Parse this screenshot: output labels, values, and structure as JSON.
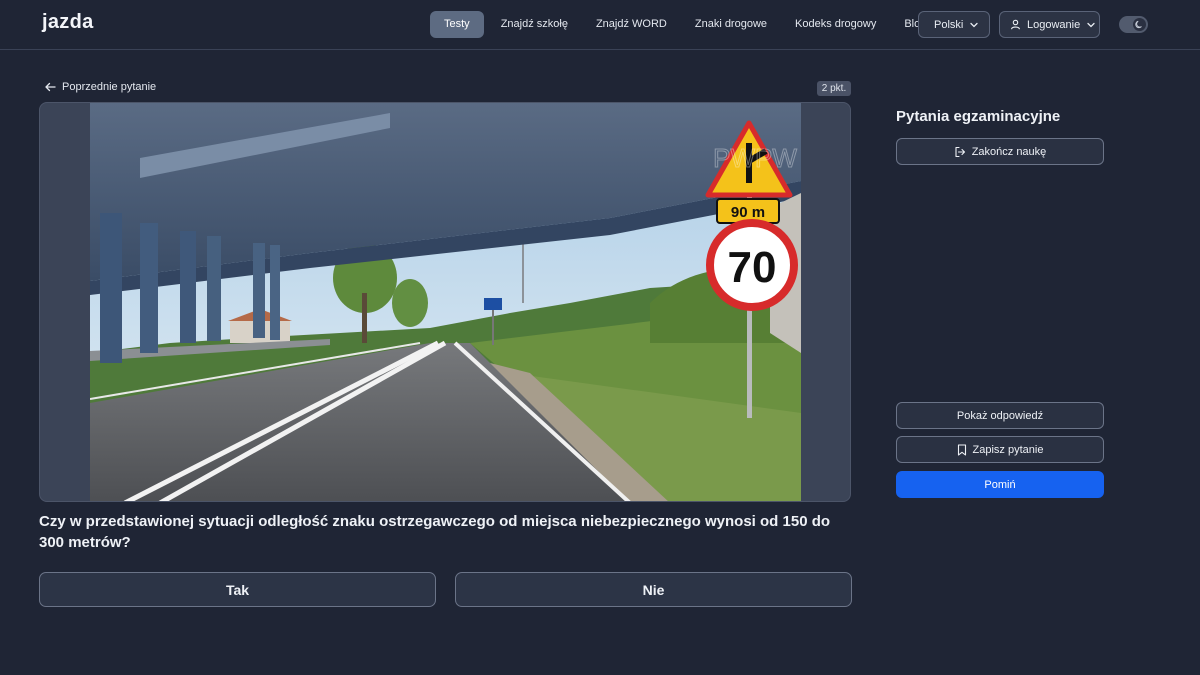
{
  "header": {
    "logo": "jazda",
    "nav": [
      {
        "label": "Testy",
        "active": true
      },
      {
        "label": "Znajdź szkołę",
        "active": false
      },
      {
        "label": "Znajdź WORD",
        "active": false
      },
      {
        "label": "Znaki drogowe",
        "active": false
      },
      {
        "label": "Kodeks drogowy",
        "active": false
      },
      {
        "label": "Blog",
        "active": false
      }
    ],
    "language_label": "Polski",
    "login_label": "Logowanie",
    "theme_toggle_icon": "moon-icon"
  },
  "main": {
    "prev_label": "Poprzednie pytanie",
    "points_label": "2 pkt.",
    "image": {
      "sign_distance_text": "90 m",
      "speed_limit_text": "70",
      "watermark_text": "PWPW"
    },
    "question": "Czy w przedstawionej sytuacji odległość znaku ostrzegawczego od miejsca niebezpiecznego wynosi od 150 do 300 metrów?",
    "answers": [
      "Tak",
      "Nie"
    ]
  },
  "sidebar": {
    "title": "Pytania egzaminacyjne",
    "end_label": "Zakończ naukę",
    "show_answer_label": "Pokaż odpowiedź",
    "save_label": "Zapisz pytanie",
    "skip_label": "Pomiń"
  },
  "colors": {
    "background": "#1f2535",
    "accent": "#1662f0",
    "active_tab": "#5d6b82"
  }
}
